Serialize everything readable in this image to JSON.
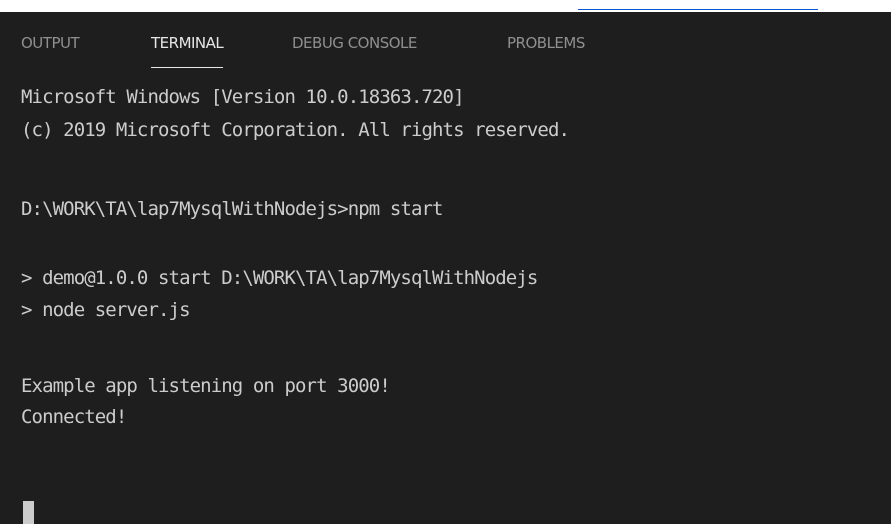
{
  "panel": {
    "tabs": [
      {
        "label": "OUTPUT",
        "active": false
      },
      {
        "label": "TERMINAL",
        "active": true
      },
      {
        "label": "DEBUG CONSOLE",
        "active": false
      },
      {
        "label": "PROBLEMS",
        "active": false
      }
    ]
  },
  "terminal": {
    "lines": [
      "Microsoft Windows [Version 10.0.18363.720]",
      "(c) 2019 Microsoft Corporation. All rights reserved.",
      "D:\\WORK\\TA\\lap7MysqlWithNodejs>npm start",
      "> demo@1.0.0 start D:\\WORK\\TA\\lap7MysqlWithNodejs",
      "> node server.js",
      "Example app listening on port 3000!",
      "Connected!"
    ]
  },
  "colors": {
    "background": "#1e1e1e",
    "text": "#cccccc",
    "tab_inactive": "#8f8f8f",
    "tab_active": "#e7e7e7",
    "link_underline": "#0b57d0"
  }
}
